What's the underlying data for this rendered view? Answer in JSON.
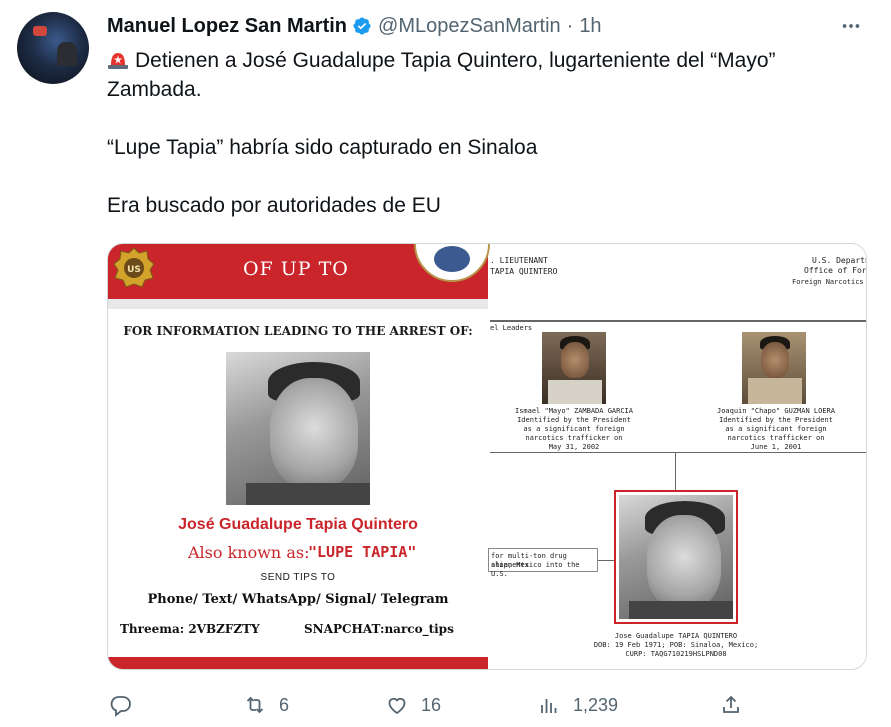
{
  "tweet": {
    "author_name": "Manuel Lopez San Martin",
    "handle": "@MLopezSanMartin",
    "separator": "·",
    "time": "1h",
    "lines": [
      "Detienen a José Guadalupe Tapia Quintero, lugarteniente del “Mayo” Zambada.",
      "“Lupe Tapia” habría sido capturado en Sinaloa",
      "Era buscado por autoridades de EU"
    ]
  },
  "poster_left": {
    "header": "OF UP TO",
    "intro": "FOR INFORMATION LEADING TO THE ARREST OF:",
    "full_name": "José Guadalupe Tapia Quintero",
    "aka_label": "Also known as:",
    "aka_value": "\"LUPE TAPIA\"",
    "send_tips": "SEND TIPS TO",
    "channels": "Phone/ Text/ WhatsApp/ Signal/ Telegram",
    "threema": "Threema: 2VBZFZTY",
    "snapchat": "SNAPCHAT:narco_tips"
  },
  "poster_right": {
    "title_line1": ". LIEUTENANT",
    "title_line2": "TAPIA QUINTERO",
    "dept_line1": "U.S. Departn",
    "dept_line2": "Office of Foreig",
    "dept_line3": "Foreign Narcotics Ki",
    "section": "el Leaders",
    "leader1": {
      "name": "Ismael \"Mayo\" ZAMBADA GARCIA",
      "l1": "Identified by the President",
      "l2": "as a significant foreign",
      "l3": "narcotics trafficker on",
      "date": "May 31, 2002"
    },
    "leader2": {
      "name": "Joaquin \"Chapo\" GUZMAN LOERA",
      "l1": "Identified by the President",
      "l2": "as a significant foreign",
      "l3": "narcotics trafficker on",
      "date": "June 1, 2001"
    },
    "note1": "for multi-ton drug shipments",
    "note2": "aloa, Mexico into the U.S.",
    "subject_name": "Jose Guadalupe TAPIA QUINTERO",
    "subject_dob": "DOB: 19 Feb 1971; POB: Sinaloa, Mexico;",
    "subject_curp": "CURP: TAQG710219HSLPND08"
  },
  "stats": {
    "retweets": "6",
    "likes": "16",
    "views": "1,239"
  },
  "colors": {
    "red": "#c9252b",
    "verified_blue": "#1d9bf0",
    "muted": "#536471"
  },
  "icons": [
    "verified-badge-icon",
    "more-icon",
    "siren-icon",
    "reply-icon",
    "retweet-icon",
    "like-icon",
    "views-icon",
    "share-icon"
  ]
}
